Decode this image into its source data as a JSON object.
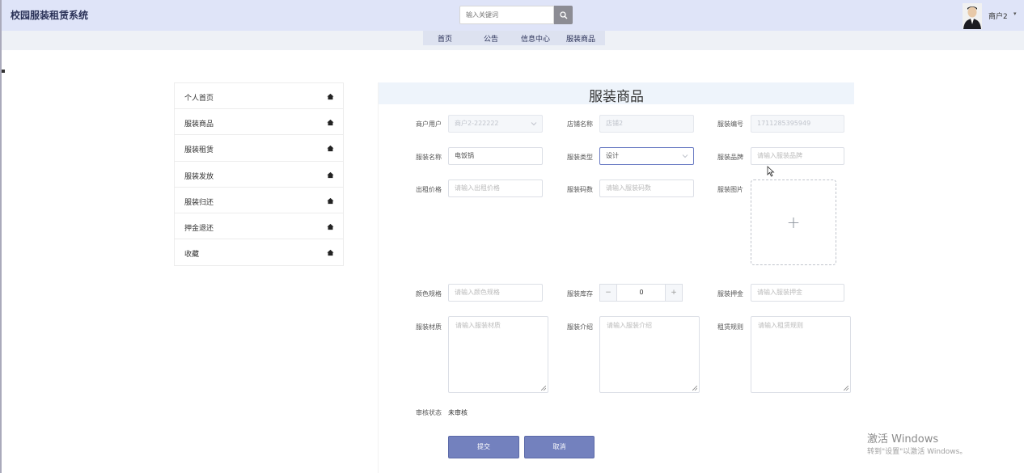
{
  "header": {
    "app_title": "校园服装租赁系统",
    "search_placeholder": "输入关键词",
    "user_name": "商户2",
    "user_caret": "▾"
  },
  "nav": {
    "items": [
      "首页",
      "公告",
      "信息中心",
      "服装商品"
    ]
  },
  "sidebar": {
    "items": [
      {
        "label": "个人首页",
        "icon": "home-icon"
      },
      {
        "label": "服装商品",
        "icon": "home-icon"
      },
      {
        "label": "服装租赁",
        "icon": "home-icon"
      },
      {
        "label": "服装发放",
        "icon": "home-icon"
      },
      {
        "label": "服装归还",
        "icon": "home-icon"
      },
      {
        "label": "押金退还",
        "icon": "home-icon"
      },
      {
        "label": "收藏",
        "icon": "home-icon"
      }
    ]
  },
  "form": {
    "title": "服装商品",
    "merchant_user": {
      "label": "商户用户",
      "value": "商户2-222222"
    },
    "shop_name": {
      "label": "店铺名称",
      "value": "店铺2"
    },
    "clothing_code": {
      "label": "服装编号",
      "value": "1711285395949"
    },
    "clothing_name": {
      "label": "服装名称",
      "value": "电饭锅"
    },
    "clothing_type": {
      "label": "服装类型",
      "value": "设计"
    },
    "clothing_brand": {
      "label": "服装品牌",
      "placeholder": "请输入服装品牌"
    },
    "rent_price": {
      "label": "出租价格",
      "placeholder": "请输入出租价格"
    },
    "clothing_size": {
      "label": "服装码数",
      "placeholder": "请输入服装码数"
    },
    "clothing_image": {
      "label": "服装图片",
      "plus": "+"
    },
    "color_spec": {
      "label": "颜色规格",
      "placeholder": "请输入颜色规格"
    },
    "stock": {
      "label": "服装库存",
      "value": "0",
      "minus": "−",
      "plus": "+"
    },
    "deposit": {
      "label": "服装押金",
      "placeholder": "请输入服装押金"
    },
    "material": {
      "label": "服装材质",
      "placeholder": "请输入服装材质"
    },
    "intro": {
      "label": "服装介绍",
      "placeholder": "请输入服装介绍"
    },
    "rules": {
      "label": "租赁规则",
      "placeholder": "请输入租赁规则"
    },
    "review_status": {
      "label": "审核状态",
      "value": "未审核"
    },
    "submit_label": "提交",
    "cancel_label": "取消"
  },
  "watermark": {
    "line1": "激活 Windows",
    "line2": "转到\"设置\"以激活 Windows。"
  },
  "colors": {
    "topbar_bg": "#dfe4f8",
    "accent": "#7381be",
    "title_text": "#2a3157"
  }
}
